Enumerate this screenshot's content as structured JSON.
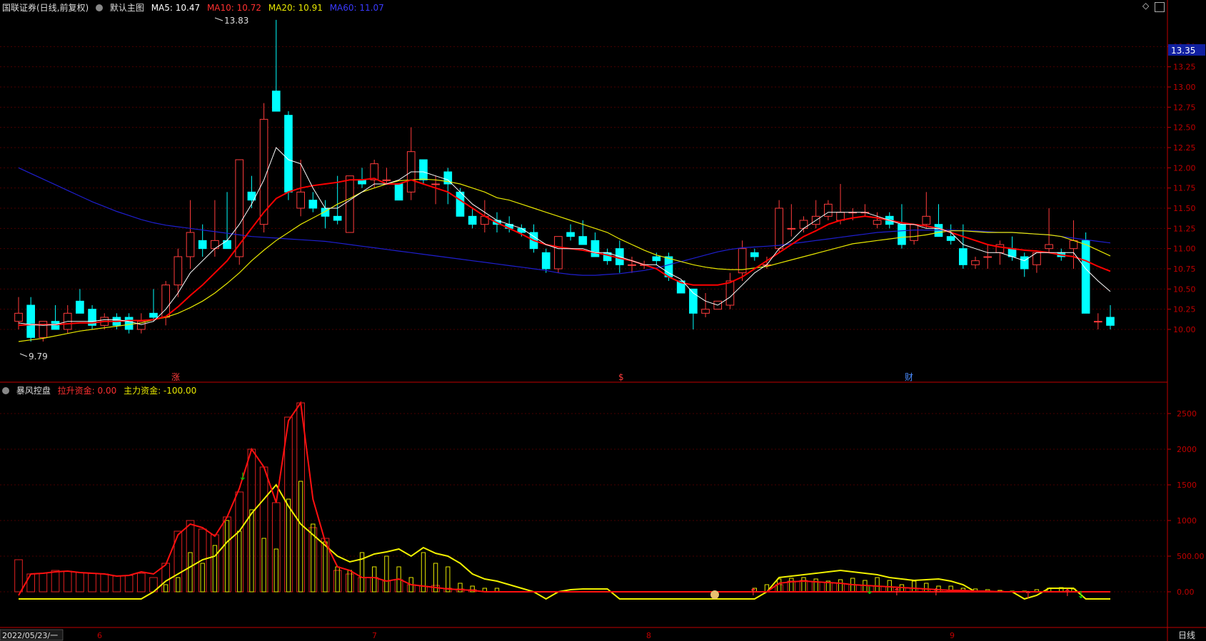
{
  "header": {
    "title": "国联证券(日线,前复权)",
    "main_chart": "默认主图",
    "ma5": "MA5: 10.47",
    "ma10": "MA10: 10.72",
    "ma20": "MA20: 10.91",
    "ma60": "MA60: 11.07"
  },
  "indicator": {
    "name": "暴风控盘",
    "v1": "拉升资金: 0.00",
    "v2": "主力资金: -100.00"
  },
  "bottom": {
    "date": "2022/05/23/一",
    "months": [
      "6",
      "7",
      "8",
      "9"
    ],
    "period": "日线"
  },
  "colors": {
    "up": "#ff3c3c",
    "down": "#00ffff",
    "ma5": "#ffffff",
    "ma10": "#ff0000",
    "ma20": "#e8e800",
    "ma60": "#1f1fd0",
    "axis": "#c00000"
  },
  "price_axis": {
    "ticks": [
      "13.50",
      "13.25",
      "13.00",
      "12.75",
      "12.50",
      "12.25",
      "12.00",
      "11.75",
      "11.50",
      "11.25",
      "11.00",
      "10.75",
      "10.50",
      "10.25",
      "10.00"
    ],
    "current": "13.35",
    "high_label": "13.83",
    "low_label": "9.79"
  },
  "ind_axis": {
    "ticks": [
      "2500",
      "2000",
      "1500",
      "1000",
      "500.00",
      "0.00"
    ]
  },
  "markers": [
    "涨",
    "$",
    "财"
  ],
  "chart_data": [
    {
      "type": "candlestick",
      "title": "国联证券(日线,前复权)",
      "ylim": [
        9.4,
        13.9
      ],
      "candles": [
        [
          10.1,
          10.4,
          10.0,
          10.2
        ],
        [
          10.3,
          10.4,
          9.85,
          9.9
        ],
        [
          9.9,
          10.0,
          9.85,
          10.1
        ],
        [
          10.1,
          10.3,
          10.0,
          10.0
        ],
        [
          10.0,
          10.3,
          9.95,
          10.2
        ],
        [
          10.35,
          10.5,
          10.2,
          10.2
        ],
        [
          10.25,
          10.3,
          10.0,
          10.05
        ],
        [
          10.05,
          10.2,
          10.0,
          10.15
        ],
        [
          10.15,
          10.2,
          10.0,
          10.05
        ],
        [
          10.15,
          10.2,
          9.95,
          10.0
        ],
        [
          10.0,
          10.2,
          9.95,
          10.1
        ],
        [
          10.2,
          10.5,
          10.1,
          10.15
        ],
        [
          10.15,
          10.6,
          10.05,
          10.55
        ],
        [
          10.55,
          11.0,
          10.4,
          10.9
        ],
        [
          10.9,
          11.6,
          10.75,
          11.2
        ],
        [
          11.1,
          11.3,
          10.9,
          11.0
        ],
        [
          11.0,
          11.6,
          10.9,
          11.1
        ],
        [
          11.1,
          11.7,
          11.0,
          11.0
        ],
        [
          10.9,
          12.1,
          10.8,
          12.1
        ],
        [
          11.7,
          11.9,
          11.5,
          11.6
        ],
        [
          11.3,
          12.8,
          11.2,
          12.6
        ],
        [
          12.95,
          13.83,
          12.7,
          12.7
        ],
        [
          12.65,
          12.7,
          11.6,
          11.7
        ],
        [
          11.5,
          12.1,
          11.4,
          11.7
        ],
        [
          11.6,
          11.7,
          11.45,
          11.5
        ],
        [
          11.5,
          11.6,
          11.25,
          11.4
        ],
        [
          11.4,
          11.9,
          11.3,
          11.35
        ],
        [
          11.2,
          11.8,
          11.2,
          11.9
        ],
        [
          11.85,
          12.0,
          11.75,
          11.8
        ],
        [
          11.85,
          12.1,
          11.75,
          12.05
        ],
        [
          11.85,
          12.0,
          11.8,
          11.85
        ],
        [
          11.8,
          11.8,
          11.6,
          11.6
        ],
        [
          11.7,
          12.5,
          11.6,
          12.2
        ],
        [
          12.1,
          12.1,
          11.8,
          11.85
        ],
        [
          11.8,
          11.9,
          11.55,
          11.8
        ],
        [
          11.95,
          12.0,
          11.55,
          11.8
        ],
        [
          11.7,
          11.75,
          11.4,
          11.4
        ],
        [
          11.4,
          11.5,
          11.25,
          11.3
        ],
        [
          11.3,
          11.6,
          11.2,
          11.4
        ],
        [
          11.35,
          11.45,
          11.2,
          11.3
        ],
        [
          11.3,
          11.4,
          11.2,
          11.25
        ],
        [
          11.25,
          11.3,
          11.15,
          11.2
        ],
        [
          11.2,
          11.3,
          10.95,
          11.0
        ],
        [
          10.95,
          11.0,
          10.7,
          10.75
        ],
        [
          10.75,
          11.15,
          10.7,
          11.15
        ],
        [
          11.2,
          11.3,
          11.1,
          11.15
        ],
        [
          11.15,
          11.35,
          11.05,
          11.05
        ],
        [
          11.1,
          11.2,
          10.9,
          10.9
        ],
        [
          10.95,
          11.0,
          10.8,
          10.85
        ],
        [
          11.0,
          11.1,
          10.7,
          10.8
        ],
        [
          10.8,
          10.9,
          10.7,
          10.8
        ],
        [
          10.8,
          10.85,
          10.75,
          10.8
        ],
        [
          10.9,
          10.95,
          10.8,
          10.85
        ],
        [
          10.9,
          10.95,
          10.6,
          10.65
        ],
        [
          10.6,
          10.6,
          10.45,
          10.45
        ],
        [
          10.5,
          10.5,
          10.0,
          10.2
        ],
        [
          10.2,
          10.45,
          10.15,
          10.25
        ],
        [
          10.25,
          10.35,
          10.25,
          10.35
        ],
        [
          10.3,
          10.7,
          10.25,
          10.6
        ],
        [
          10.7,
          11.1,
          10.6,
          11.0
        ],
        [
          10.95,
          11.0,
          10.85,
          10.9
        ],
        [
          10.8,
          10.9,
          10.75,
          10.8
        ],
        [
          11.0,
          11.6,
          10.95,
          11.5
        ],
        [
          11.25,
          11.55,
          11.15,
          11.25
        ],
        [
          11.25,
          11.4,
          11.2,
          11.35
        ],
        [
          11.3,
          11.6,
          11.25,
          11.4
        ],
        [
          11.4,
          11.6,
          11.35,
          11.55
        ],
        [
          11.35,
          11.8,
          11.3,
          11.45
        ],
        [
          11.45,
          11.5,
          11.35,
          11.45
        ],
        [
          11.45,
          11.55,
          11.4,
          11.45
        ],
        [
          11.3,
          11.45,
          11.25,
          11.35
        ],
        [
          11.4,
          11.45,
          11.25,
          11.3
        ],
        [
          11.3,
          11.55,
          11.0,
          11.05
        ],
        [
          11.1,
          11.3,
          11.05,
          11.3
        ],
        [
          11.3,
          11.7,
          11.25,
          11.4
        ],
        [
          11.3,
          11.55,
          11.15,
          11.15
        ],
        [
          11.15,
          11.3,
          11.05,
          11.1
        ],
        [
          11.0,
          11.3,
          10.75,
          10.8
        ],
        [
          10.8,
          10.9,
          10.75,
          10.85
        ],
        [
          10.9,
          11.05,
          10.75,
          10.9
        ],
        [
          10.95,
          11.1,
          10.8,
          11.05
        ],
        [
          11.0,
          11.15,
          10.85,
          10.9
        ],
        [
          10.9,
          10.95,
          10.65,
          10.75
        ],
        [
          10.8,
          10.95,
          10.7,
          10.95
        ],
        [
          11.0,
          11.5,
          10.95,
          11.05
        ],
        [
          10.95,
          11.0,
          10.85,
          10.9
        ],
        [
          11.0,
          11.35,
          10.75,
          11.1
        ],
        [
          11.1,
          11.2,
          10.2,
          10.2
        ],
        [
          10.1,
          10.2,
          10.0,
          10.1
        ],
        [
          10.15,
          10.3,
          10.0,
          10.05
        ]
      ],
      "ma5": [
        10.08,
        10.06,
        10.05,
        10.06,
        10.1,
        10.1,
        10.1,
        10.12,
        10.12,
        10.1,
        10.06,
        10.1,
        10.25,
        10.45,
        10.7,
        10.85,
        11.0,
        11.1,
        11.3,
        11.55,
        11.85,
        12.25,
        12.1,
        12.05,
        11.75,
        11.5,
        11.5,
        11.6,
        11.7,
        11.8,
        11.8,
        11.85,
        11.95,
        11.95,
        11.9,
        11.85,
        11.7,
        11.55,
        11.45,
        11.35,
        11.3,
        11.25,
        11.15,
        11.05,
        11.0,
        11.0,
        11.0,
        10.95,
        10.95,
        10.9,
        10.85,
        10.8,
        10.8,
        10.7,
        10.62,
        10.45,
        10.35,
        10.3,
        10.4,
        10.55,
        10.7,
        10.8,
        11.0,
        11.1,
        11.25,
        11.35,
        11.45,
        11.45,
        11.45,
        11.45,
        11.4,
        11.35,
        11.3,
        11.3,
        11.25,
        11.25,
        11.2,
        11.05,
        11.0,
        10.95,
        10.95,
        10.9,
        10.85,
        10.95,
        10.95,
        10.95,
        10.95,
        10.75,
        10.6,
        10.47
      ],
      "ma10": [
        10.05,
        10.06,
        10.06,
        10.06,
        10.07,
        10.08,
        10.08,
        10.1,
        10.1,
        10.11,
        10.11,
        10.12,
        10.16,
        10.28,
        10.42,
        10.55,
        10.7,
        10.85,
        11.05,
        11.25,
        11.45,
        11.62,
        11.7,
        11.75,
        11.78,
        11.8,
        11.82,
        11.85,
        11.85,
        11.87,
        11.8,
        11.8,
        11.85,
        11.8,
        11.75,
        11.7,
        11.6,
        11.5,
        11.4,
        11.32,
        11.25,
        11.18,
        11.1,
        11.05,
        11.02,
        11.0,
        10.98,
        10.95,
        10.92,
        10.88,
        10.85,
        10.8,
        10.75,
        10.65,
        10.58,
        10.55,
        10.55,
        10.55,
        10.58,
        10.65,
        10.75,
        10.85,
        10.95,
        11.05,
        11.15,
        11.22,
        11.3,
        11.35,
        11.38,
        11.4,
        11.38,
        11.35,
        11.32,
        11.3,
        11.28,
        11.25,
        11.2,
        11.15,
        11.1,
        11.05,
        11.02,
        11.0,
        10.98,
        10.97,
        10.95,
        10.92,
        10.9,
        10.85,
        10.78,
        10.72
      ],
      "ma20": [
        9.85,
        9.87,
        9.89,
        9.92,
        9.95,
        9.98,
        10.0,
        10.02,
        10.04,
        10.06,
        10.08,
        10.12,
        10.15,
        10.2,
        10.27,
        10.35,
        10.45,
        10.57,
        10.7,
        10.85,
        10.98,
        11.1,
        11.2,
        11.3,
        11.38,
        11.46,
        11.55,
        11.62,
        11.7,
        11.75,
        11.8,
        11.84,
        11.85,
        11.86,
        11.85,
        11.83,
        11.8,
        11.75,
        11.7,
        11.63,
        11.6,
        11.55,
        11.5,
        11.45,
        11.4,
        11.35,
        11.3,
        11.25,
        11.2,
        11.12,
        11.05,
        10.98,
        10.92,
        10.88,
        10.84,
        10.8,
        10.77,
        10.75,
        10.74,
        10.74,
        10.76,
        10.78,
        10.82,
        10.86,
        10.9,
        10.94,
        10.98,
        11.02,
        11.06,
        11.08,
        11.1,
        11.12,
        11.14,
        11.15,
        11.17,
        11.2,
        11.22,
        11.22,
        11.21,
        11.2,
        11.2,
        11.2,
        11.19,
        11.18,
        11.17,
        11.15,
        11.1,
        11.05,
        10.98,
        10.91
      ],
      "ma60": [
        12.0,
        11.93,
        11.86,
        11.79,
        11.72,
        11.65,
        11.58,
        11.52,
        11.46,
        11.41,
        11.36,
        11.32,
        11.29,
        11.27,
        11.25,
        11.23,
        11.21,
        11.19,
        11.17,
        11.15,
        11.14,
        11.13,
        11.12,
        11.11,
        11.1,
        11.09,
        11.07,
        11.05,
        11.03,
        11.01,
        10.99,
        10.97,
        10.95,
        10.93,
        10.91,
        10.89,
        10.87,
        10.85,
        10.83,
        10.81,
        10.79,
        10.77,
        10.75,
        10.73,
        10.7,
        10.68,
        10.67,
        10.67,
        10.68,
        10.69,
        10.71,
        10.73,
        10.76,
        10.8,
        10.84,
        10.88,
        10.92,
        10.96,
        10.99,
        11.01,
        11.02,
        11.03,
        11.04,
        11.06,
        11.08,
        11.1,
        11.12,
        11.14,
        11.16,
        11.18,
        11.2,
        11.21,
        11.22,
        11.23,
        11.23,
        11.23,
        11.23,
        11.22,
        11.22,
        11.21,
        11.2,
        11.2,
        11.19,
        11.18,
        11.17,
        11.15,
        11.13,
        11.11,
        11.09,
        11.07
      ]
    },
    {
      "type": "bar",
      "title": "暴风控盘",
      "ylim": [
        -450,
        2750
      ],
      "red_bars": [
        450,
        250,
        260,
        300,
        290,
        270,
        260,
        250,
        220,
        230,
        260,
        200,
        400,
        850,
        1000,
        880,
        800,
        1050,
        1400,
        2000,
        1750,
        1250,
        2450,
        2650,
        900,
        750,
        300,
        250,
        200,
        200,
        150,
        170,
        100,
        80,
        90,
        50,
        40,
        30,
        0,
        0,
        0,
        0,
        0,
        0,
        0,
        0,
        0,
        0,
        0,
        0,
        0,
        0,
        0,
        0,
        0,
        0,
        0,
        0,
        0,
        0,
        0,
        0,
        100,
        150,
        160,
        140,
        130,
        120,
        100,
        90,
        80,
        70,
        60,
        50,
        40,
        30,
        20,
        20,
        10,
        10,
        10,
        0,
        0,
        0,
        0,
        0,
        0,
        0,
        0,
        0
      ],
      "yellow_bars": [
        0,
        0,
        0,
        0,
        0,
        0,
        0,
        0,
        0,
        0,
        0,
        0,
        100,
        200,
        550,
        400,
        650,
        1000,
        850,
        1150,
        750,
        600,
        1300,
        1550,
        950,
        700,
        350,
        300,
        550,
        350,
        500,
        350,
        200,
        550,
        400,
        350,
        120,
        80,
        50,
        50,
        0,
        0,
        0,
        0,
        0,
        0,
        0,
        0,
        0,
        0,
        0,
        0,
        0,
        0,
        0,
        0,
        0,
        0,
        0,
        0,
        50,
        100,
        180,
        190,
        200,
        180,
        150,
        170,
        190,
        160,
        200,
        160,
        100,
        150,
        120,
        80,
        80,
        50,
        40,
        30,
        20,
        10,
        10,
        30,
        50,
        60,
        40,
        0,
        0,
        0
      ],
      "red_line": [
        -50,
        250,
        260,
        280,
        290,
        270,
        260,
        250,
        220,
        230,
        280,
        250,
        380,
        800,
        950,
        900,
        780,
        1050,
        1450,
        2000,
        1750,
        1250,
        2400,
        2650,
        1300,
        700,
        350,
        300,
        200,
        200,
        150,
        180,
        100,
        80,
        60,
        40,
        30,
        20,
        0,
        0,
        0,
        0,
        0,
        0,
        0,
        0,
        0,
        0,
        0,
        0,
        0,
        0,
        0,
        0,
        0,
        0,
        0,
        0,
        0,
        0,
        0,
        0,
        120,
        140,
        150,
        140,
        130,
        120,
        100,
        90,
        80,
        70,
        60,
        50,
        40,
        30,
        20,
        20,
        10,
        10,
        0,
        0,
        0,
        0,
        0,
        0,
        0,
        0,
        0,
        0
      ],
      "yellow_line": [
        -100,
        -100,
        -100,
        -100,
        -100,
        -100,
        -100,
        -100,
        -100,
        -100,
        -100,
        0,
        150,
        250,
        350,
        450,
        500,
        700,
        850,
        1100,
        1300,
        1500,
        1200,
        950,
        800,
        650,
        500,
        420,
        460,
        530,
        560,
        600,
        500,
        620,
        540,
        500,
        400,
        250,
        180,
        150,
        100,
        50,
        0,
        -100,
        0,
        30,
        40,
        40,
        40,
        -100,
        -100,
        -100,
        -100,
        -100,
        -100,
        -100,
        -100,
        -100,
        -100,
        -100,
        -100,
        0,
        200,
        220,
        240,
        260,
        280,
        300,
        280,
        260,
        240,
        200,
        180,
        160,
        170,
        180,
        150,
        100,
        0,
        0,
        0,
        0,
        -100,
        -50,
        50,
        50,
        50,
        -100,
        -100,
        -100
      ]
    }
  ]
}
